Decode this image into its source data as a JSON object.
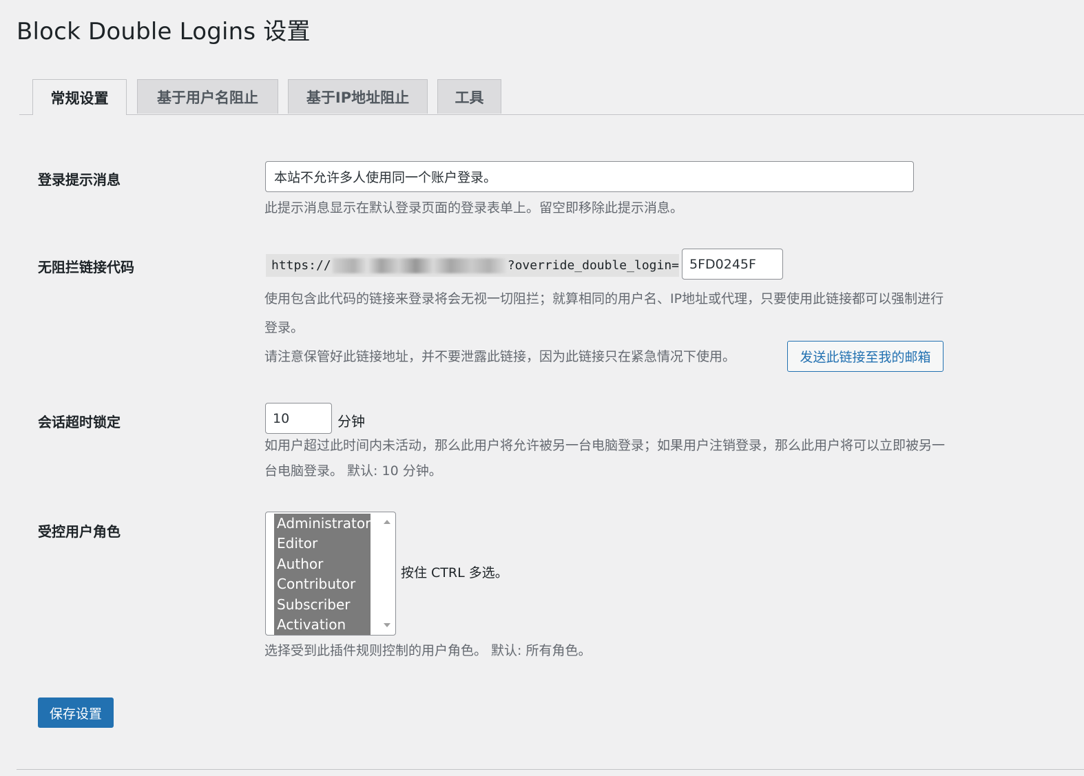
{
  "page": {
    "title": "Block Double Logins 设置"
  },
  "tabs": [
    {
      "label": "常规设置",
      "active": true
    },
    {
      "label": "基于用户名阻止",
      "active": false
    },
    {
      "label": "基于IP地址阻止",
      "active": false
    },
    {
      "label": "工具",
      "active": false
    }
  ],
  "login_message": {
    "label": "登录提示消息",
    "value": "本站不允许多人使用同一个账户登录。",
    "description": "此提示消息显示在默认登录页面的登录表单上。留空即移除此提示消息。"
  },
  "override_link": {
    "label": "无阻拦链接代码",
    "url_start": "https://",
    "url_end": "?override_double_login=",
    "code": "5FD0245F",
    "description_1": "使用包含此代码的链接来登录将会无视一切阻拦；就算相同的用户名、IP地址或代理，只要使用此链接都可以强制进行",
    "description_2": "登录。",
    "description_3": "请注意保管好此链接地址，并不要泄露此链接，因为此链接只在紧急情况下使用。",
    "send_button": "发送此链接至我的邮箱"
  },
  "session_timeout": {
    "label": "会话超时锁定",
    "value": "10",
    "unit": "分钟",
    "description_1": "如用户超过此时间内未活动，那么此用户将允许被另一台电脑登录；如果用户注销登录，那么此用户将可以立即被另一",
    "description_2": "台电脑登录。 默认: 10 分钟。"
  },
  "roles": {
    "label": "受控用户角色",
    "options": [
      "Administrator",
      "Editor",
      "Author",
      "Contributor",
      "Subscriber",
      "Activation"
    ],
    "hint": "按住 CTRL 多选。",
    "description": "选择受到此插件规则控制的用户角色。 默认: 所有角色。"
  },
  "save_button": "保存设置"
}
